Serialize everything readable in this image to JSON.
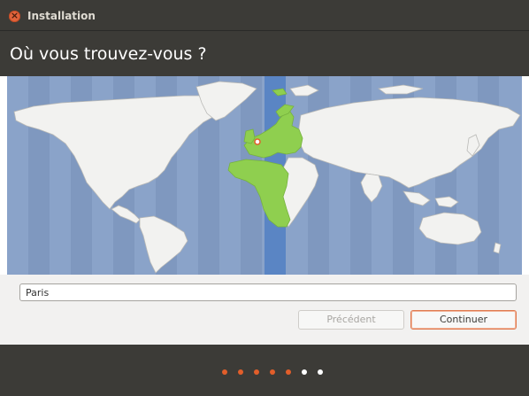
{
  "window": {
    "title": "Installation"
  },
  "header": {
    "title": "Où vous trouvez-vous ?"
  },
  "timezone": {
    "city": "Paris",
    "selected_band_color": "#5a85c4",
    "highlight_color": "#8fcf4f"
  },
  "buttons": {
    "previous": "Précédent",
    "continue": "Continuer"
  },
  "progress": {
    "total_steps": 7,
    "completed_steps": 5,
    "completed_color": "#e25e2a",
    "pending_color": "#ffffff"
  }
}
